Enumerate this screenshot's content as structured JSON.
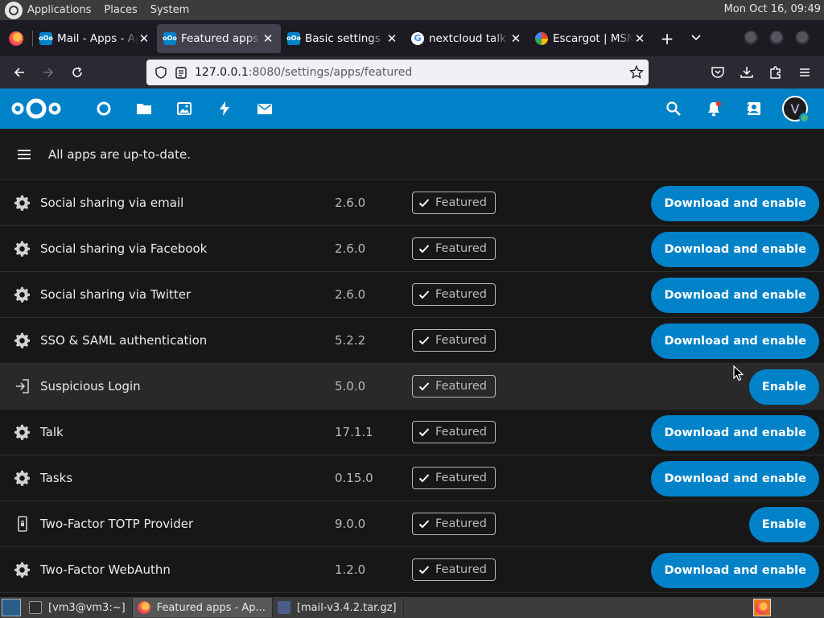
{
  "system_panel": {
    "menus": [
      "Applications",
      "Places",
      "System"
    ],
    "clock": "Mon Oct 16, 09:49"
  },
  "browser": {
    "tabs": [
      {
        "title": "Mail - Apps - Apps",
        "icon": "nextcloud-icon",
        "active": false
      },
      {
        "title": "Featured apps - Apps",
        "icon": "nextcloud-icon",
        "active": true
      },
      {
        "title": "Basic settings - Settings",
        "icon": "nextcloud-icon",
        "active": false
      },
      {
        "title": "nextcloud talk download",
        "icon": "google-icon",
        "active": false
      },
      {
        "title": "Escargot | MSN Messenger",
        "icon": "escargot-icon",
        "active": false
      }
    ],
    "url_host": "127.0.0.1",
    "url_rest": ":8080/settings/apps/featured"
  },
  "nextcloud": {
    "header_apps": [
      "dashboard-icon",
      "files-icon",
      "photos-icon",
      "activity-icon",
      "mail-icon"
    ],
    "user_initial": "V",
    "status_message": "All apps are up-to-date.",
    "featured_label": "Featured",
    "apps": [
      {
        "name": "Social sharing via email",
        "version": "2.6.0",
        "action": "Download and enable",
        "icon": "gear-icon"
      },
      {
        "name": "Social sharing via Facebook",
        "version": "2.6.0",
        "action": "Download and enable",
        "icon": "gear-icon"
      },
      {
        "name": "Social sharing via Twitter",
        "version": "2.6.0",
        "action": "Download and enable",
        "icon": "gear-icon"
      },
      {
        "name": "SSO & SAML authentication",
        "version": "5.2.2",
        "action": "Download and enable",
        "icon": "gear-icon"
      },
      {
        "name": "Suspicious Login",
        "version": "5.0.0",
        "action": "Enable",
        "icon": "login-icon"
      },
      {
        "name": "Talk",
        "version": "17.1.1",
        "action": "Download and enable",
        "icon": "gear-icon"
      },
      {
        "name": "Tasks",
        "version": "0.15.0",
        "action": "Download and enable",
        "icon": "gear-icon"
      },
      {
        "name": "Two-Factor TOTP Provider",
        "version": "9.0.0",
        "action": "Enable",
        "icon": "phone-lock-icon"
      },
      {
        "name": "Two-Factor WebAuthn",
        "version": "1.2.0",
        "action": "Download and enable",
        "icon": "gear-icon"
      }
    ]
  },
  "taskbar": {
    "items": [
      {
        "label": "[vm3@vm3:~]",
        "icon": "terminal-icon",
        "active": false
      },
      {
        "label": "Featured apps - Ap...",
        "icon": "firefox-icon",
        "active": true
      },
      {
        "label": "[mail-v3.4.2.tar.gz]",
        "icon": "archive-icon",
        "active": false
      }
    ]
  }
}
